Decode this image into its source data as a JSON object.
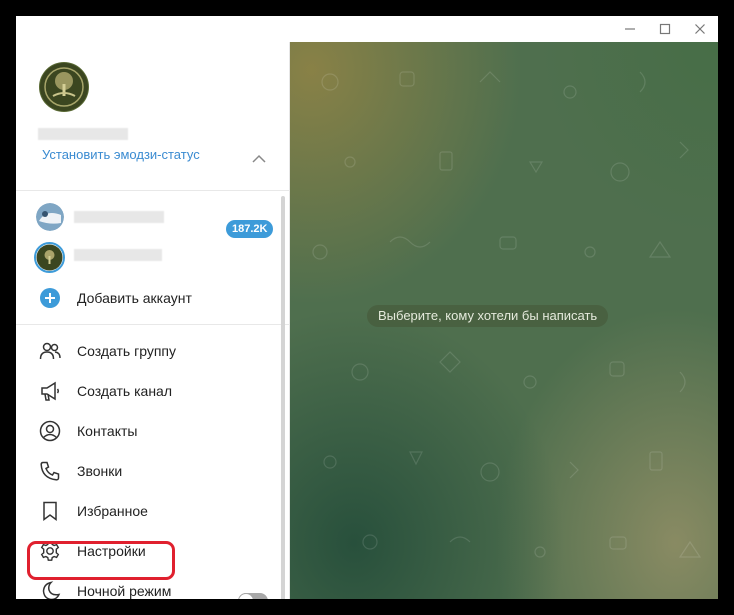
{
  "window": {
    "controls": [
      "minimize-icon",
      "maximize-icon",
      "close-icon"
    ]
  },
  "profile": {
    "status_link": "Установить эмодзи-статус"
  },
  "accounts": {
    "badge": "187.2K",
    "add_label": "Добавить аккаунт"
  },
  "menu": {
    "items": [
      {
        "label": "Создать группу",
        "icon": "group-icon"
      },
      {
        "label": "Создать канал",
        "icon": "megaphone-icon"
      },
      {
        "label": "Контакты",
        "icon": "contact-icon"
      },
      {
        "label": "Звонки",
        "icon": "phone-icon"
      },
      {
        "label": "Избранное",
        "icon": "bookmark-icon"
      },
      {
        "label": "Настройки",
        "icon": "gear-icon"
      },
      {
        "label": "Ночной режим",
        "icon": "moon-icon"
      }
    ],
    "night_mode_enabled": false
  },
  "chat": {
    "hint": "Выберите, кому хотели бы написать"
  },
  "colors": {
    "accent": "#3a8bd1",
    "badge": "#3d9bd9",
    "highlight": "#e0202e",
    "text": "#222222"
  }
}
